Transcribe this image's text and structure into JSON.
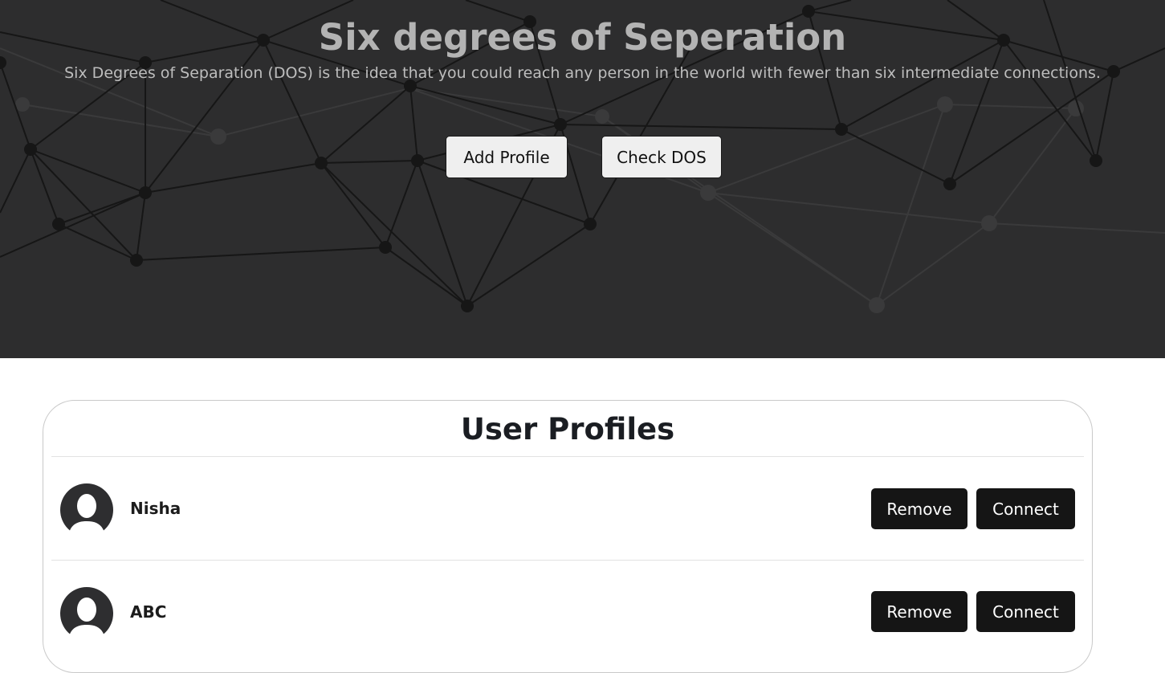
{
  "hero": {
    "title": "Six degrees of Seperation",
    "subtitle": "Six Degrees of Separation (DOS) is the idea that you could reach any person in the world with fewer than six intermediate connections.",
    "buttons": {
      "add_profile": "Add Profile",
      "check_dos": "Check DOS"
    }
  },
  "profiles": {
    "heading": "User Profiles",
    "users": [
      {
        "name": "Nisha",
        "remove_label": "Remove",
        "connect_label": "Connect",
        "icon": "user-avatar-icon"
      },
      {
        "name": "ABC",
        "remove_label": "Remove",
        "connect_label": "Connect",
        "icon": "user-avatar-icon"
      }
    ]
  },
  "colors": {
    "hero_bg": "#2d2d2e",
    "title": "#b3b3b3",
    "action_button_bg": "#151515",
    "action_button_text": "#ffffff"
  }
}
